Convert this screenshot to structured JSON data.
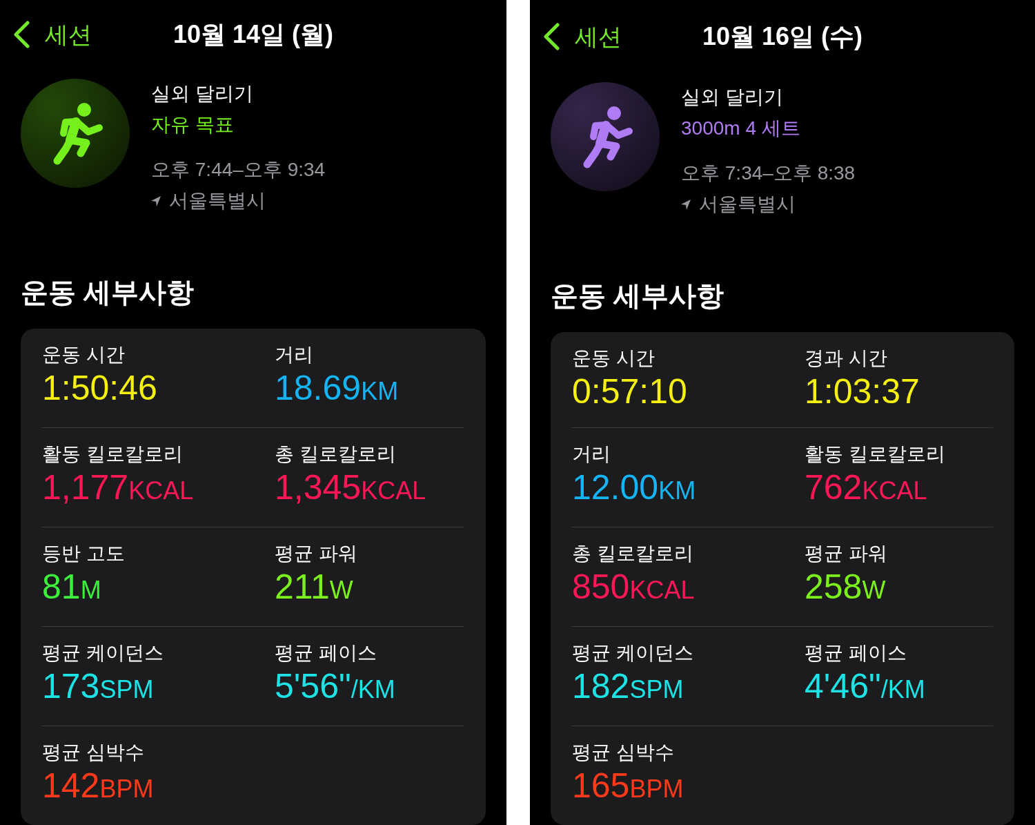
{
  "screens": [
    {
      "nav": {
        "back_label": "세션",
        "title": "10월 14일 (월)"
      },
      "workout": {
        "name": "실외 달리기",
        "goal": "자유 목표",
        "time_range": "오후 7:44–오후 9:34",
        "location": "서울특별시",
        "color": "#76f01c"
      },
      "section_title": "운동 세부사항",
      "metrics": [
        {
          "label": "운동 시간",
          "value": "1:50:46",
          "color": "#f5f00f"
        },
        {
          "label": "거리",
          "value": "18.69",
          "unit": "KM",
          "color": "#14b4f5"
        },
        {
          "label": "활동 킬로칼로리",
          "value": "1,177",
          "unit": "KCAL",
          "color": "#ff1756"
        },
        {
          "label": "총 킬로칼로리",
          "value": "1,345",
          "unit": "KCAL",
          "color": "#ff1756"
        },
        {
          "label": "등반 고도",
          "value": "81",
          "unit": "M",
          "color": "#3cf03c"
        },
        {
          "label": "평균 파워",
          "value": "211",
          "unit": "W",
          "color": "#7cf01c"
        },
        {
          "label": "평균 케이던스",
          "value": "173",
          "unit": "SPM",
          "color": "#1ee3e6"
        },
        {
          "label": "평균 페이스",
          "value": "5'56\"",
          "unit": "/KM",
          "color": "#1ee3e6"
        },
        {
          "label": "평균 심박수",
          "value": "142",
          "unit": "BPM",
          "color": "#ff3a1a"
        }
      ]
    },
    {
      "nav": {
        "back_label": "세션",
        "title": "10월 16일 (수)"
      },
      "workout": {
        "name": "실외 달리기",
        "goal": "3000m 4 세트",
        "time_range": "오후 7:34–오후 8:38",
        "location": "서울특별시",
        "color": "#b07cf5"
      },
      "section_title": "운동 세부사항",
      "metrics": [
        {
          "label": "운동 시간",
          "value": "0:57:10",
          "color": "#f5f00f"
        },
        {
          "label": "경과 시간",
          "value": "1:03:37",
          "color": "#f5f00f"
        },
        {
          "label": "거리",
          "value": "12.00",
          "unit": "KM",
          "color": "#14b4f5"
        },
        {
          "label": "활동 킬로칼로리",
          "value": "762",
          "unit": "KCAL",
          "color": "#ff1756"
        },
        {
          "label": "총 킬로칼로리",
          "value": "850",
          "unit": "KCAL",
          "color": "#ff1756"
        },
        {
          "label": "평균 파워",
          "value": "258",
          "unit": "W",
          "color": "#7cf01c"
        },
        {
          "label": "평균 케이던스",
          "value": "182",
          "unit": "SPM",
          "color": "#1ee3e6"
        },
        {
          "label": "평균 페이스",
          "value": "4'46\"",
          "unit": "/KM",
          "color": "#1ee3e6"
        },
        {
          "label": "평균 심박수",
          "value": "165",
          "unit": "BPM",
          "color": "#ff3a1a"
        }
      ]
    }
  ]
}
